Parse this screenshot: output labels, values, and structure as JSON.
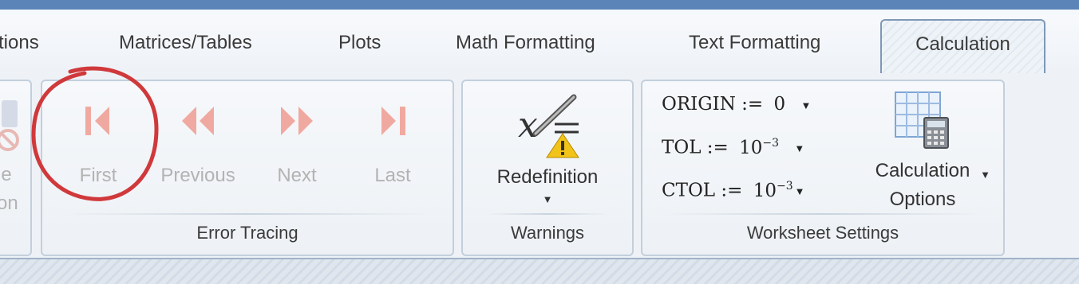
{
  "tabs": [
    {
      "label": "tions"
    },
    {
      "label": "Matrices/Tables"
    },
    {
      "label": "Plots"
    },
    {
      "label": "Math Formatting"
    },
    {
      "label": "Text Formatting"
    },
    {
      "label": "Calculation"
    }
  ],
  "active_tab": "Calculation",
  "partial_group": {
    "line1": "le",
    "line2": "on"
  },
  "error_tracing": {
    "group_label": "Error Tracing",
    "first": "First",
    "previous": "Previous",
    "next": "Next",
    "last": "Last"
  },
  "warnings": {
    "group_label": "Warnings",
    "redefinition": "Redefinition"
  },
  "worksheet_settings": {
    "group_label": "Worksheet Settings",
    "origin": {
      "name": "ORIGIN",
      "op": ":=",
      "value": "0"
    },
    "tol": {
      "name": "TOL",
      "op": ":=",
      "base": "10",
      "exp": "−3"
    },
    "ctol": {
      "name": "CTOL",
      "op": ":=",
      "base": "10",
      "exp": "−3"
    },
    "calc_options_line1": "Calculation",
    "calc_options_line2": "Options"
  },
  "colors": {
    "accent_bar": "#5b84b8",
    "disabled_icon": "#f0a9a0",
    "annotation_circle": "#d0393b",
    "warning_yellow": "#f2c318"
  },
  "icons": [
    "first-icon",
    "previous-icon",
    "next-icon",
    "last-icon",
    "redefinition-warning-icon",
    "calculation-options-icon",
    "caret-down-icon"
  ]
}
